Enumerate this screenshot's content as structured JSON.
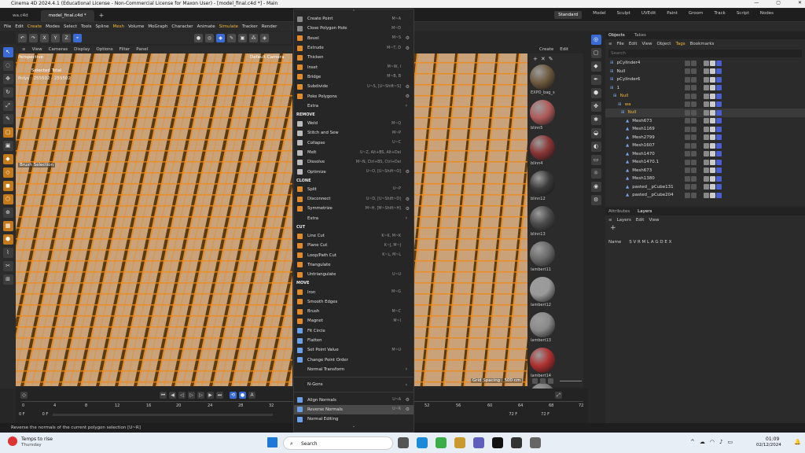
{
  "window": {
    "title": "Cinema 4D 2024.4.1 (Educational License - Non-Commercial License for Maxon User) - [model_final.c4d *] - Main",
    "min": "—",
    "max": "▢",
    "close": "✕"
  },
  "doc_tabs": [
    {
      "label": "wa.c4d"
    },
    {
      "label": "model_final.c4d *"
    }
  ],
  "layouts": [
    "Standard",
    "Model",
    "Sculpt",
    "UVEdit",
    "Paint",
    "Groom",
    "Track",
    "Script",
    "Nodes"
  ],
  "menubar": [
    "File",
    "Edit",
    "Create",
    "Modes",
    "Select",
    "Tools",
    "Spline",
    "Mesh",
    "Volume",
    "MoGraph",
    "Character",
    "Animate",
    "Simulate",
    "Tracker",
    "Render"
  ],
  "viewport": {
    "menu": [
      "View",
      "Cameras",
      "Display",
      "Options",
      "Filter",
      "Panel"
    ],
    "label": "Perspective",
    "camera": "Default Camera",
    "selected_total": "Selected Total",
    "polys": "Polys : 255502 - 255502",
    "brush_selection": "Brush Selection",
    "grid_spacing": "Grid Spacing : 500 cm"
  },
  "materials": {
    "menu": [
      "Create",
      "Edit"
    ],
    "items": [
      {
        "name": "EXPO_bag_s",
        "color": "#6e5a3e"
      },
      {
        "name": "blinn5",
        "color": "#b05a5a"
      },
      {
        "name": "blinn4",
        "color": "#8a3434"
      },
      {
        "name": "blinn12",
        "color": "#3a3a3a"
      },
      {
        "name": "blinn13",
        "color": "#4a4a4a"
      },
      {
        "name": "lambert11",
        "color": "#6a6a6a"
      },
      {
        "name": "lambert12",
        "color": "#9a9a9a"
      },
      {
        "name": "lambert13",
        "color": "#8a8a8a"
      },
      {
        "name": "lambert14",
        "color": "#b03030"
      },
      {
        "name": "",
        "color": "#7a7a7a"
      }
    ]
  },
  "objects": {
    "tabs": [
      "Objects",
      "Takes"
    ],
    "menu": [
      "File",
      "Edit",
      "View",
      "Object",
      "Tags",
      "Bookmarks"
    ],
    "search_placeholder": "Search",
    "rows": [
      {
        "name": "pCylinder4"
      },
      {
        "name": "Null"
      },
      {
        "name": "pCylinder6"
      },
      {
        "name": "1"
      },
      {
        "name": "Null"
      },
      {
        "name": "wa"
      },
      {
        "name": "Null"
      },
      {
        "name": "Mesh673"
      },
      {
        "name": "Mesh1169"
      },
      {
        "name": "Mesh2799"
      },
      {
        "name": "Mesh1607"
      },
      {
        "name": "Mesh1470"
      },
      {
        "name": "Mesh1470.1"
      },
      {
        "name": "Mesh673"
      },
      {
        "name": "Mesh1380"
      },
      {
        "name": "pasted__pCube131"
      },
      {
        "name": "pasted__pCube204"
      }
    ]
  },
  "attributes": {
    "tabs": [
      "Attributes",
      "Layers"
    ],
    "menu": [
      "Layers",
      "Edit",
      "View"
    ],
    "header_name": "Name",
    "header_flags": "S V R M L A G D E X"
  },
  "timeline": {
    "ticks": [
      "0",
      "4",
      "8",
      "12",
      "16",
      "20",
      "24",
      "28",
      "32",
      "52",
      "56",
      "60",
      "64",
      "68",
      "72"
    ],
    "start_frame": "0 F",
    "current_frame": "0 F",
    "end_frame": "72 F",
    "end_frame2": "72 F"
  },
  "menu": {
    "items": [
      {
        "type": "item",
        "label": "Create Point",
        "shortcut": "M~A",
        "icon": "#888"
      },
      {
        "type": "item",
        "label": "Close Polygon Hole",
        "shortcut": "M~D",
        "icon": "#888"
      },
      {
        "type": "item",
        "label": "Bevel",
        "shortcut": "M~S",
        "icon": "#e08a2c",
        "gear": true
      },
      {
        "type": "item",
        "label": "Extrude",
        "shortcut": "M~T, D",
        "icon": "#e08a2c",
        "gear": true
      },
      {
        "type": "item",
        "label": "Thicken",
        "shortcut": "",
        "icon": "#e08a2c"
      },
      {
        "type": "item",
        "label": "Inset",
        "shortcut": "M~W, I",
        "icon": "#e08a2c"
      },
      {
        "type": "item",
        "label": "Bridge",
        "shortcut": "M~B, B",
        "icon": "#e08a2c"
      },
      {
        "type": "item",
        "label": "Subdivide",
        "shortcut": "U~S, [U~Shift~S]",
        "icon": "#e08a2c",
        "gear": true
      },
      {
        "type": "item",
        "label": "Poke Polygons",
        "shortcut": "",
        "icon": "#e08a2c",
        "gear": true
      },
      {
        "type": "sub",
        "label": "Extra"
      },
      {
        "type": "section",
        "label": "REMOVE"
      },
      {
        "type": "item",
        "label": "Weld",
        "shortcut": "M~Q",
        "icon": "#bbb"
      },
      {
        "type": "item",
        "label": "Stitch and Sew",
        "shortcut": "M~P",
        "icon": "#bbb"
      },
      {
        "type": "item",
        "label": "Collapse",
        "shortcut": "U~C",
        "icon": "#bbb"
      },
      {
        "type": "item",
        "label": "Melt",
        "shortcut": "U~Z, Alt+BS, Alt+Del",
        "icon": "#bbb"
      },
      {
        "type": "item",
        "label": "Dissolve",
        "shortcut": "M~N, Ctrl+BS, Ctrl+Del",
        "icon": "#bbb"
      },
      {
        "type": "item",
        "label": "Optimize",
        "shortcut": "U~O, [U~Shift~O]",
        "icon": "#bbb",
        "gear": true
      },
      {
        "type": "section",
        "label": "CLONE"
      },
      {
        "type": "item",
        "label": "Split",
        "shortcut": "U~P",
        "icon": "#e08a2c"
      },
      {
        "type": "item",
        "label": "Disconnect",
        "shortcut": "U~D, [U~Shift~D]",
        "icon": "#e08a2c",
        "gear": true
      },
      {
        "type": "item",
        "label": "Symmetrize",
        "shortcut": "M~H, [M~Shift~H]",
        "icon": "#e08a2c",
        "gear": true
      },
      {
        "type": "sub",
        "label": "Extra"
      },
      {
        "type": "section",
        "label": "CUT"
      },
      {
        "type": "item",
        "label": "Line Cut",
        "shortcut": "K~K, M~K",
        "icon": "#e08a2c"
      },
      {
        "type": "item",
        "label": "Plane Cut",
        "shortcut": "K~J, M~J",
        "icon": "#e08a2c"
      },
      {
        "type": "item",
        "label": "Loop/Path Cut",
        "shortcut": "K~L, M~L",
        "icon": "#e08a2c"
      },
      {
        "type": "item",
        "label": "Triangulate",
        "shortcut": "",
        "icon": "#e08a2c"
      },
      {
        "type": "item",
        "label": "Untriangulate",
        "shortcut": "U~U",
        "icon": "#e08a2c"
      },
      {
        "type": "section",
        "label": "MOVE"
      },
      {
        "type": "item",
        "label": "Iron",
        "shortcut": "M~G",
        "icon": "#e08a2c"
      },
      {
        "type": "item",
        "label": "Smooth Edges",
        "shortcut": "",
        "icon": "#e08a2c"
      },
      {
        "type": "item",
        "label": "Brush",
        "shortcut": "M~C",
        "icon": "#e08a2c"
      },
      {
        "type": "item",
        "label": "Magnet",
        "shortcut": "M~I",
        "icon": "#e08a2c"
      },
      {
        "type": "item",
        "label": "Fit Circle",
        "shortcut": "",
        "icon": "#6aa0e8"
      },
      {
        "type": "item",
        "label": "Flatten",
        "shortcut": "",
        "icon": "#6aa0e8"
      },
      {
        "type": "item",
        "label": "Set Point Value",
        "shortcut": "M~U",
        "icon": "#6aa0e8"
      },
      {
        "type": "item",
        "label": "Change Point Order",
        "shortcut": "",
        "icon": "#6aa0e8"
      },
      {
        "type": "sub",
        "label": "Normal Transform"
      },
      {
        "type": "divider"
      },
      {
        "type": "sub",
        "label": "N-Gons"
      },
      {
        "type": "divider"
      },
      {
        "type": "item",
        "label": "Align Normals",
        "shortcut": "U~A",
        "icon": "#6aa0e8",
        "gear": true
      },
      {
        "type": "item",
        "label": "Reverse Normals",
        "shortcut": "U~R",
        "icon": "#6aa0e8",
        "gear": true,
        "highlight": true
      },
      {
        "type": "item",
        "label": "Normal Editing",
        "shortcut": "",
        "icon": "#6aa0e8"
      }
    ]
  },
  "status": "Reverse the normals of the current polygon selection [U~R]",
  "taskbar": {
    "weather_title": "Temps to rise",
    "weather_sub": "Thursday",
    "search_label": "Search",
    "time": "01:09",
    "date": "02/12/2024"
  }
}
